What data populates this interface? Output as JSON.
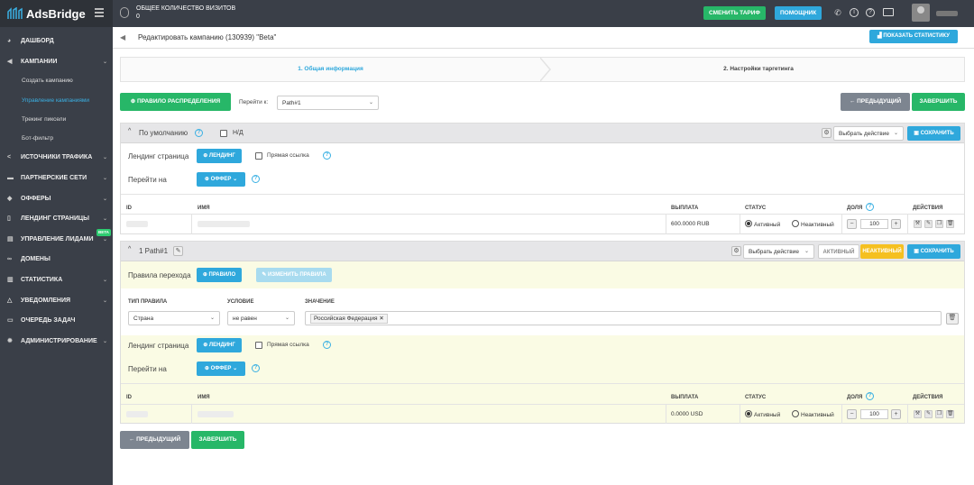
{
  "brand": {
    "name": "AdsBridge"
  },
  "header": {
    "visits_label": "ОБЩЕЕ КОЛИЧЕСТВО ВИЗИТОВ",
    "visits_value": "0",
    "change_plan": "СМЕНИТЬ ТАРИФ",
    "help": "ПОМОЩНИК",
    "icons": [
      "phone-icon",
      "info-icon",
      "question-icon",
      "id-card-icon"
    ]
  },
  "sidebar": {
    "items": [
      {
        "label": "ДАШБОРД",
        "icon": "dashboard-icon"
      },
      {
        "label": "КАМПАНИИ",
        "icon": "megaphone-icon"
      },
      {
        "label": "ИСТОЧНИКИ ТРАФИКА",
        "icon": "share-icon"
      },
      {
        "label": "ПАРТНЕРСКИЕ СЕТИ",
        "icon": "network-icon"
      },
      {
        "label": "ОФФЕРЫ",
        "icon": "tag-icon"
      },
      {
        "label": "ЛЕНДИНГ СТРАНИЦЫ",
        "icon": "page-icon"
      },
      {
        "label": "УПРАВЛЕНИЕ ЛИДАМИ",
        "icon": "leads-icon"
      },
      {
        "label": "ДОМЕНЫ",
        "icon": "link-icon"
      },
      {
        "label": "СТАТИСТИКА",
        "icon": "chart-icon"
      },
      {
        "label": "УВЕДОМЛЕНИЯ",
        "icon": "bell-icon"
      },
      {
        "label": "ОЧЕРЕДЬ ЗАДАЧ",
        "icon": "queue-icon"
      },
      {
        "label": "АДМИНИСТРИРОВАНИЕ",
        "icon": "gear-icon"
      }
    ],
    "sub_items": [
      "Создать кампанию",
      "Управление кампаниями",
      "Трекинг пиксели",
      "Бот-фильтр"
    ],
    "beta": "Beta"
  },
  "page": {
    "title": "Редактировать кампанию (130939) \"Beta\"",
    "show_stats": "ПОКАЗАТЬ СТАТИСТИКУ",
    "step1": "1. Общая информация",
    "step2": "2. Настройки таргетинга",
    "add_rule": "ПРАВИЛО РАСПРЕДЕЛЕНИЯ",
    "goto_label": "Перейти к:",
    "goto_value": "Path#1",
    "prev": "← ПРЕДЫДУЩИЙ",
    "finish": "ЗАВЕРШИТЬ"
  },
  "default_panel": {
    "title": "По умолчанию",
    "na": "Н/Д",
    "select_action": "Выбрать действие",
    "save": "СОХРАНИТЬ",
    "landing_label": "Лендинг страница",
    "landing_btn": "ЛЕНДИНГ",
    "direct_link": "Прямая ссылка",
    "goto_label": "Перейти на",
    "offer_btn": "ОФФЕР",
    "columns": [
      "ID",
      "ИМЯ",
      "ВЫПЛАТА",
      "СТАТУС",
      "ДОЛЯ",
      "ДЕЙСТВИЯ"
    ],
    "row": {
      "payout": "600.0000 RUB",
      "active": "Активный",
      "inactive": "Неактивный",
      "share": "100"
    }
  },
  "path_panel": {
    "title": "1 Path#1",
    "select_action": "Выбрать действие",
    "active": "АКТИВНЫЙ",
    "inactive": "НЕАКТИВНЫЙ",
    "save": "СОХРАНИТЬ",
    "rules_label": "Правила перехода",
    "rule_btn": "ПРАВИЛО",
    "edit_rules": "ИЗМЕНИТЬ ПРАВИЛА",
    "rule_type_h": "ТИП ПРАВИЛА",
    "condition_h": "УСЛОВИЕ",
    "value_h": "ЗНАЧЕНИЕ",
    "rule_type": "Страна",
    "condition": "не равен",
    "value_tag": "Российская Федерация",
    "landing_label": "Лендинг страница",
    "landing_btn": "ЛЕНДИНГ",
    "direct_link": "Прямая ссылка",
    "goto_label": "Перейти на",
    "offer_btn": "ОФФЕР",
    "columns": [
      "ID",
      "ИМЯ",
      "ВЫПЛАТА",
      "СТАТУС",
      "ДОЛЯ",
      "ДЕЙСТВИЯ"
    ],
    "row": {
      "payout": "0.0000 USD",
      "active": "Активный",
      "inactive": "Неактивный",
      "share": "100"
    }
  },
  "colors": {
    "green": "#27b768",
    "blue": "#2fa8dc",
    "gray": "#7d8590",
    "yellow": "#f5c020",
    "sidebar": "#3a3f48"
  }
}
